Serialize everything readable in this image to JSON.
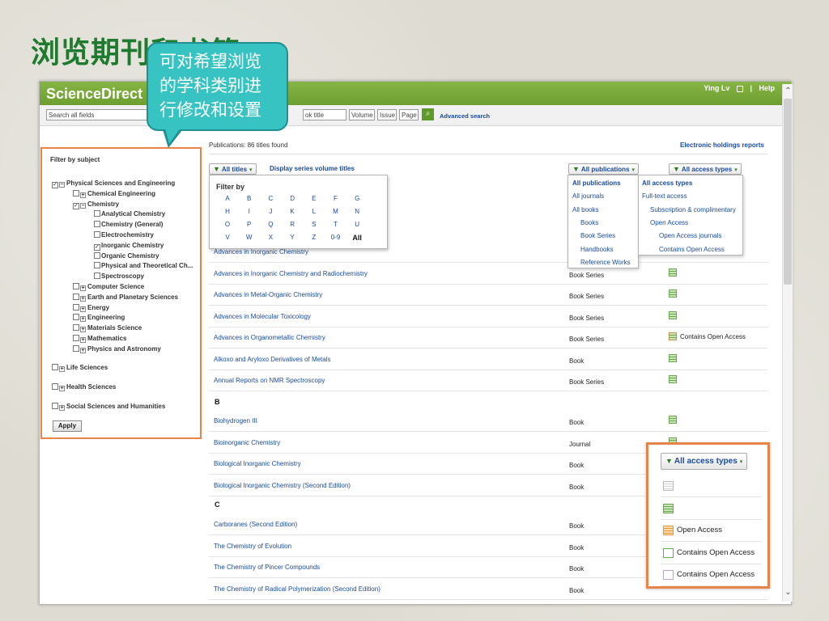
{
  "slide": {
    "title": "浏览期刊和书籍",
    "callout": [
      "可对希望浏览",
      "的学科类别进",
      "行修改和设置"
    ]
  },
  "app": {
    "logo": "ScienceDirect",
    "user_name": "Ying Lv",
    "help": "Help",
    "search_placeholder": "Search all fields",
    "book_title_field": "ok title",
    "volume_field": "Volume",
    "issue_field": "Issue",
    "page_field": "Page",
    "advanced_search": "Advanced search"
  },
  "sidebar": {
    "heading": "Filter by subject",
    "tree": [
      {
        "label": "Physical Sciences and Engineering",
        "checked": true,
        "expanded": true,
        "level": 0
      },
      {
        "label": "Chemical Engineering",
        "checked": false,
        "expanded": false,
        "level": 1
      },
      {
        "label": "Chemistry",
        "checked": true,
        "expanded": true,
        "level": 1
      },
      {
        "label": "Analytical Chemistry",
        "checked": false,
        "level": 2
      },
      {
        "label": "Chemistry (General)",
        "checked": false,
        "level": 2
      },
      {
        "label": "Electrochemistry",
        "checked": false,
        "level": 2
      },
      {
        "label": "Inorganic Chemistry",
        "checked": true,
        "level": 2
      },
      {
        "label": "Organic Chemistry",
        "checked": false,
        "level": 2
      },
      {
        "label": "Physical and Theoretical Ch...",
        "checked": false,
        "level": 2
      },
      {
        "label": "Spectroscopy",
        "checked": false,
        "level": 2
      },
      {
        "label": "Computer Science",
        "checked": false,
        "expanded": false,
        "level": 1
      },
      {
        "label": "Earth and Planetary Sciences",
        "checked": false,
        "expanded": false,
        "level": 1
      },
      {
        "label": "Energy",
        "checked": false,
        "expanded": false,
        "level": 1
      },
      {
        "label": "Engineering",
        "checked": false,
        "expanded": false,
        "level": 1
      },
      {
        "label": "Materials Science",
        "checked": false,
        "expanded": false,
        "level": 1
      },
      {
        "label": "Mathematics",
        "checked": false,
        "expanded": false,
        "level": 1
      },
      {
        "label": "Physics and Astronomy",
        "checked": false,
        "expanded": false,
        "level": 1
      }
    ],
    "top_groups": [
      "Life Sciences",
      "Health Sciences",
      "Social Sciences and Humanities"
    ],
    "apply": "Apply"
  },
  "main": {
    "count_text": "Publications: 86 titles found",
    "holdings_link": "Electronic holdings reports",
    "all_titles": "All titles",
    "series_link": "Display series volume titles",
    "all_publications": "All publications",
    "all_access_types": "All access types",
    "rows": [
      {
        "title": "Advances in Inorganic Chemistry",
        "type": "",
        "access": "",
        "icon": "sub"
      },
      {
        "title": "Advances in Inorganic Chemistry and Radiochemistry",
        "type": "Book Series",
        "access": "",
        "icon": "sub"
      },
      {
        "title": "Advances in Metal-Organic Chemistry",
        "type": "Book Series",
        "access": "",
        "icon": "sub"
      },
      {
        "title": "Advances in Molecular Toxicology",
        "type": "Book Series",
        "access": "",
        "icon": "sub"
      },
      {
        "title": "Advances in Organometallic Chemistry",
        "type": "Book Series",
        "access": "Contains Open Access",
        "icon": "mix"
      },
      {
        "title": "Alkoxo and Aryloxo Derivatives of Metals",
        "type": "Book",
        "access": "",
        "icon": "sub"
      },
      {
        "title": "Annual Reports on NMR Spectroscopy",
        "type": "Book Series",
        "access": "",
        "icon": "sub"
      }
    ],
    "letter_b": "B",
    "rows_b": [
      {
        "title": "Biohydrogen III",
        "type": "Book",
        "icon": "sub"
      },
      {
        "title": "Bioinorganic Chemistry",
        "type": "Journal",
        "icon": "sub"
      },
      {
        "title": "Biological Inorganic Chemistry",
        "type": "Book",
        "icon": "sub"
      },
      {
        "title": "Biological Inorganic Chemistry (Second Edition)",
        "type": "Book",
        "icon": "sub"
      }
    ],
    "letter_c": "C",
    "rows_c": [
      {
        "title": "Carboranes (Second Edition)",
        "type": "Book"
      },
      {
        "title": "The Chemistry of Evolution",
        "type": "Book"
      },
      {
        "title": "The Chemistry of Pincer Compounds",
        "type": "Book"
      },
      {
        "title": "The Chemistry of Radical Polymerization (Second Edition)",
        "type": "Book"
      }
    ]
  },
  "filter_popup": {
    "heading": "Filter by",
    "letters": [
      "A",
      "B",
      "C",
      "D",
      "E",
      "F",
      "G",
      "H",
      "I",
      "J",
      "K",
      "L",
      "M",
      "N",
      "O",
      "P",
      "Q",
      "R",
      "S",
      "T",
      "U",
      "V",
      "W",
      "X",
      "Y",
      "Z",
      "0-9",
      "All"
    ]
  },
  "publications_dropdown": [
    "All publications",
    "All journals",
    "All books",
    "Books",
    "Book Series",
    "Handbooks",
    "Reference Works"
  ],
  "access_dropdown": [
    "All access types",
    "Full-text access",
    "Subscription & complimentary",
    "Open Access",
    "Open Access journals",
    "Contains Open Access"
  ],
  "zoom_panel": {
    "button": "All access types",
    "items": [
      {
        "icon": "none",
        "label": ""
      },
      {
        "icon": "sub",
        "label": ""
      },
      {
        "icon": "oa",
        "label": "Open Access"
      },
      {
        "icon": "mix",
        "label": "Contains Open Access"
      },
      {
        "icon": "mix2",
        "label": "Contains Open Access"
      }
    ]
  },
  "colors": {
    "brand_green": "#6e9d31",
    "link_blue": "#1a4ba3",
    "highlight_orange": "#e8844a",
    "callout_teal": "#38c3c3"
  }
}
